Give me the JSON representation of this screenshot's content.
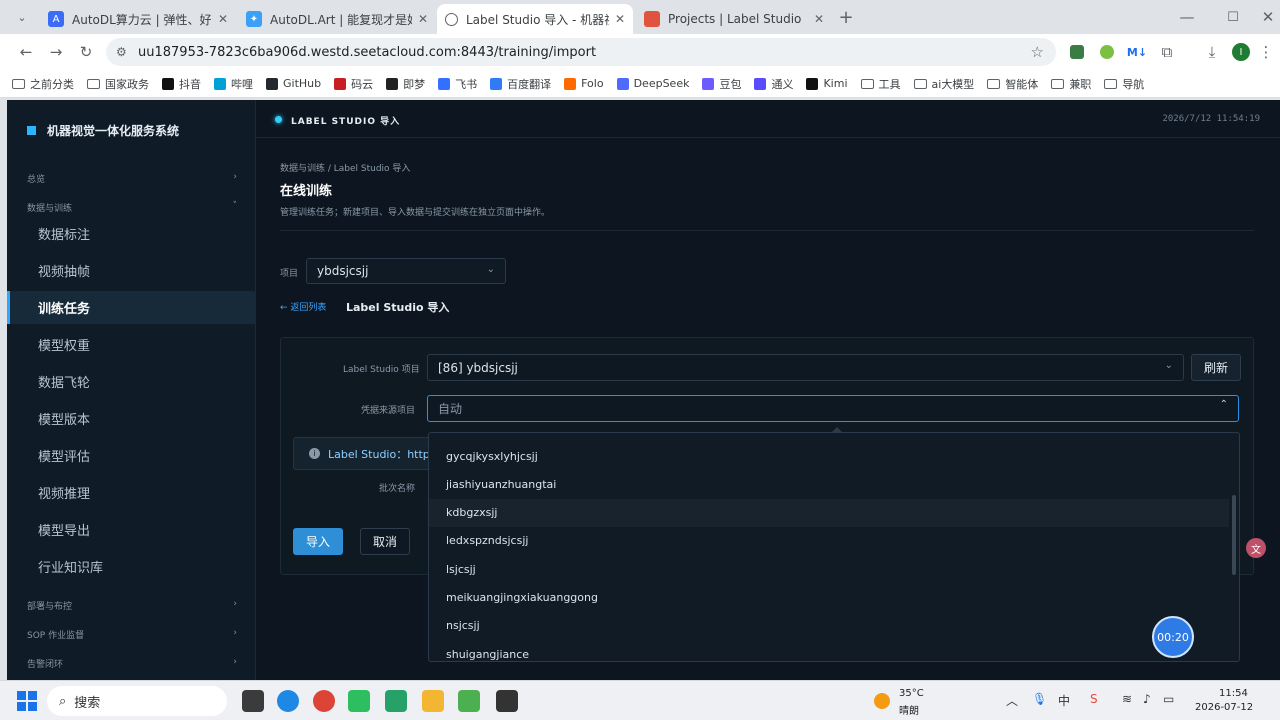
{
  "browser": {
    "tabs": [
      {
        "title": "AutoDL算力云 | 弹性、好用、",
        "favicon_color": "#3b6cf6",
        "active": false
      },
      {
        "title": "AutoDL.Art | 能复现才是好算法",
        "favicon_color": "#3ba0f6",
        "active": false
      },
      {
        "title": "Label Studio 导入 - 机器视觉一",
        "favicon_color": "#5f6368",
        "active": true
      },
      {
        "title": "Projects | Label Studio",
        "favicon_color": "#e0533f",
        "active": false
      }
    ],
    "url": "uu187953-7823c6ba906d.westd.seetacloud.com:8443/training/import",
    "bookmarks": [
      {
        "label": "之前分类",
        "icon": "folder"
      },
      {
        "label": "国家政务",
        "icon": "folder"
      },
      {
        "label": "抖音",
        "icon": "tiktok",
        "color": "#111111"
      },
      {
        "label": "哔哩",
        "icon": "bilibili",
        "color": "#00a1d6"
      },
      {
        "label": "GitHub",
        "icon": "github",
        "color": "#24292f"
      },
      {
        "label": "码云",
        "icon": "gitee",
        "color": "#c71d23"
      },
      {
        "label": "即梦",
        "icon": "jimeng",
        "color": "#222222"
      },
      {
        "label": "飞书",
        "icon": "feishu",
        "color": "#3370ff"
      },
      {
        "label": "百度翻译",
        "icon": "baidu-translate",
        "color": "#2f7cf6"
      },
      {
        "label": "Folo",
        "icon": "folo",
        "color": "#ff6a00"
      },
      {
        "label": "DeepSeek",
        "icon": "deepseek",
        "color": "#4d6bfe"
      },
      {
        "label": "豆包",
        "icon": "doubao",
        "color": "#6b5bff"
      },
      {
        "label": "通义",
        "icon": "tongyi",
        "color": "#5b4bff"
      },
      {
        "label": "Kimi",
        "icon": "kimi",
        "color": "#111111"
      },
      {
        "label": "工具",
        "icon": "folder"
      },
      {
        "label": "ai大模型",
        "icon": "folder"
      },
      {
        "label": "智能体",
        "icon": "folder"
      },
      {
        "label": "兼职",
        "icon": "folder"
      },
      {
        "label": "导航",
        "icon": "folder"
      }
    ]
  },
  "app": {
    "system_title": "机器视觉一体化服务系统",
    "top_label": "LABEL STUDIO 导入",
    "datetime": "2026/7/12 11:54:19",
    "sidebar": {
      "groups": [
        {
          "label": "总览",
          "arrow": "›"
        },
        {
          "label": "数据与训练",
          "arrow": "˅"
        },
        {
          "label": "部署与布控",
          "arrow": "›"
        },
        {
          "label": "SOP 作业监督",
          "arrow": "›"
        },
        {
          "label": "告警闭环",
          "arrow": "›"
        }
      ],
      "items": [
        "数据标注",
        "视频抽帧",
        "训练任务",
        "模型权重",
        "数据飞轮",
        "模型版本",
        "模型评估",
        "视频推理",
        "模型导出",
        "行业知识库"
      ],
      "active_item": "训练任务"
    },
    "breadcrumb": "数据与训练 / Label Studio 导入",
    "page_title": "在线训练",
    "page_desc": "管理训练任务；新建项目、导入数据与提交训练在独立页面中操作。",
    "project_label": "项目",
    "project_value": "ybdsjcsjj",
    "back_link": "← 返回列表",
    "section_title": "Label Studio 导入",
    "form": {
      "ls_project_label": "Label Studio 项目",
      "ls_project_value": "[86] ybdsjcsjj",
      "refresh": "刷新",
      "credential_label": "凭据来源项目",
      "credential_value": "自动",
      "info_text": "Label Studio：http",
      "batch_label": "批次名称",
      "import_btn": "导入",
      "cancel_btn": "取消"
    },
    "dropdown_options": [
      "gycqjkysxlyhjcsjj",
      "jiashiyuanzhuangtai",
      "kdbgzxsjj",
      "ledxspzndsjcsjj",
      "lsjcsjj",
      "meikuangjingxiakuanggong",
      "nsjcsjj",
      "shuigangjiance"
    ],
    "hovered_option": "kdbgzxsjj",
    "timer": "00:20"
  },
  "taskbar": {
    "search": "搜索",
    "weather_temp": "35°C",
    "weather_desc": "晴朗",
    "time": "11:54",
    "date": "2026-07-12"
  }
}
